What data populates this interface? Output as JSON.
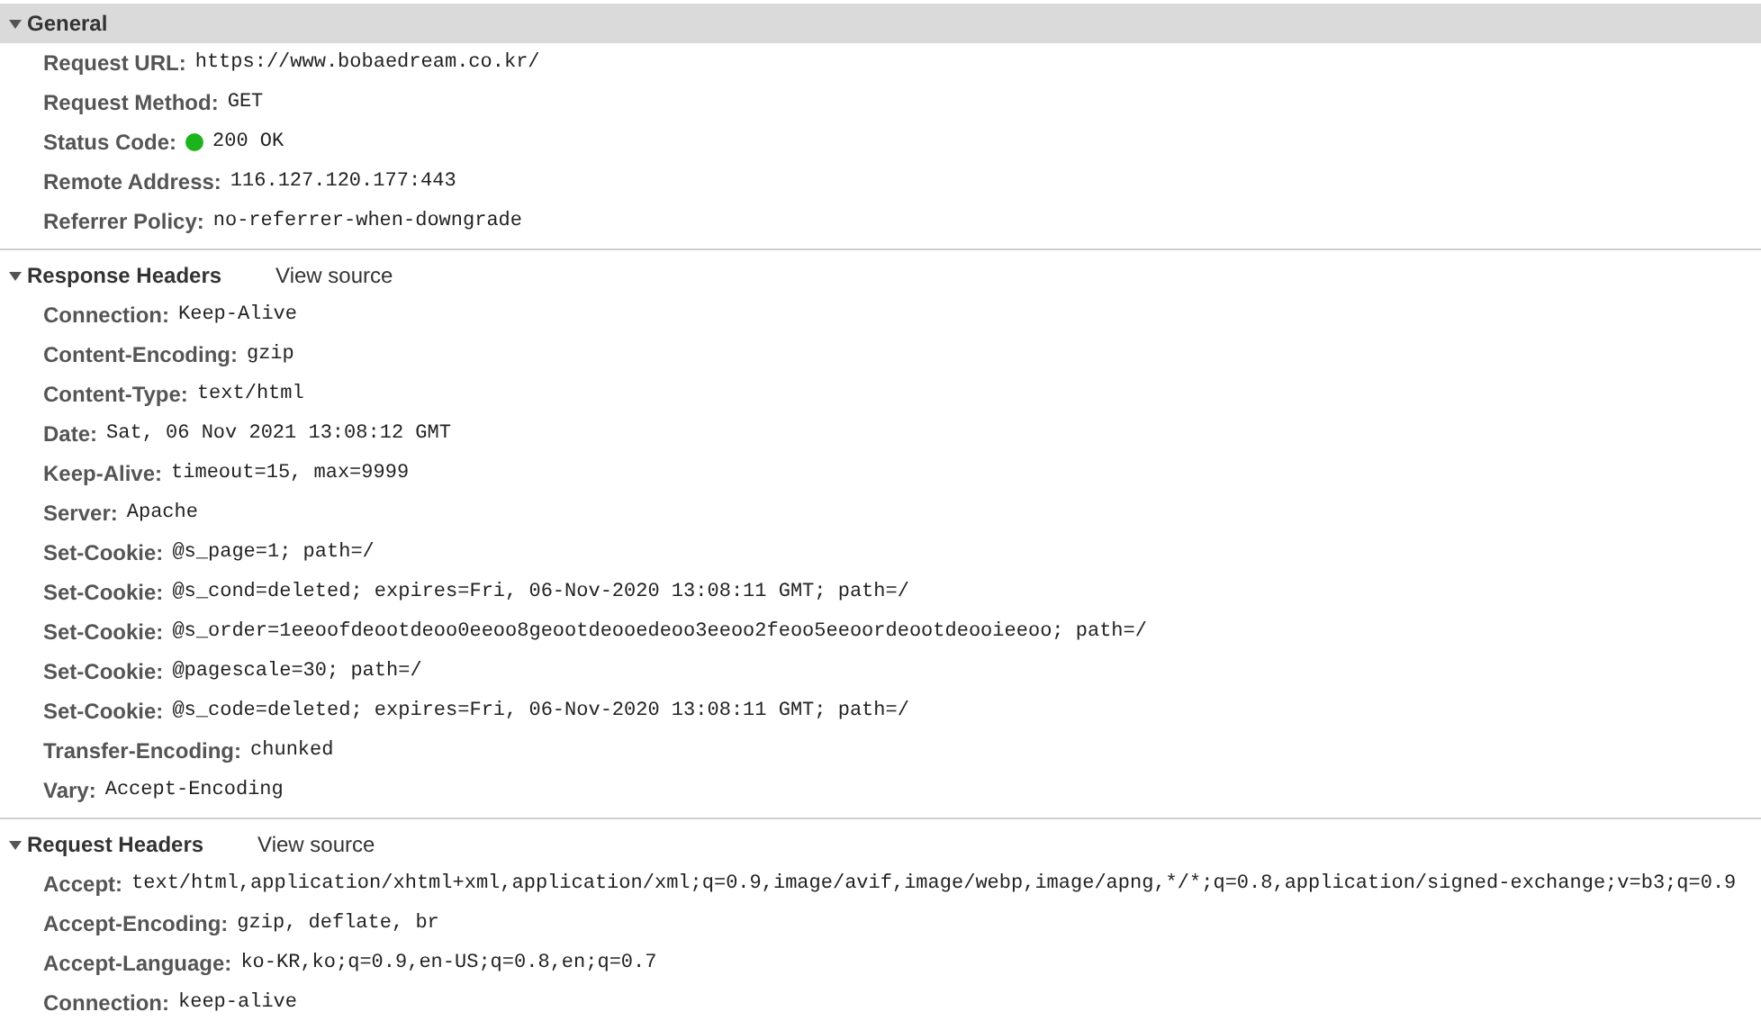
{
  "sections": [
    {
      "title": "General",
      "expanded": true,
      "selected": true,
      "rows": [
        {
          "name": "Request URL:",
          "value": "https://www.bobaedream.co.kr/"
        },
        {
          "name": "Request Method:",
          "value": "GET"
        },
        {
          "name": "Status Code:",
          "value": "200 OK",
          "color": "#1db31d"
        },
        {
          "name": "Remote Address:",
          "value": "116.127.120.177:443"
        },
        {
          "name": "Referrer Policy:",
          "value": "no-referrer-when-downgrade"
        }
      ]
    },
    {
      "title": "Response Headers",
      "link": "View source",
      "expanded": true,
      "selected": false,
      "rows": [
        {
          "name": "Connection:",
          "value": "Keep-Alive"
        },
        {
          "name": "Content-Encoding:",
          "value": "gzip"
        },
        {
          "name": "Content-Type:",
          "value": "text/html"
        },
        {
          "name": "Date:",
          "value": "Sat, 06 Nov 2021 13:08:12 GMT"
        },
        {
          "name": "Keep-Alive:",
          "value": "timeout=15, max=9999"
        },
        {
          "name": "Server:",
          "value": "Apache"
        },
        {
          "name": "Set-Cookie:",
          "value": "@s_page=1; path=/"
        },
        {
          "name": "Set-Cookie:",
          "value": "@s_cond=deleted; expires=Fri, 06-Nov-2020 13:08:11 GMT; path=/"
        },
        {
          "name": "Set-Cookie:",
          "value": "@s_order=1eeoofdeootdeoo0eeoo8geootdeooedeoo3eeoo2feoo5eeoordeootdeooieeoo; path=/"
        },
        {
          "name": "Set-Cookie:",
          "value": "@pagescale=30; path=/"
        },
        {
          "name": "Set-Cookie:",
          "value": "@s_code=deleted; expires=Fri, 06-Nov-2020 13:08:11 GMT; path=/"
        },
        {
          "name": "Transfer-Encoding:",
          "value": "chunked"
        },
        {
          "name": "Vary:",
          "value": "Accept-Encoding"
        }
      ]
    },
    {
      "title": "Request Headers",
      "link": "View source",
      "expanded": true,
      "selected": false,
      "rows": [
        {
          "name": "Accept:",
          "value": "text/html,application/xhtml+xml,application/xml;q=0.9,image/avif,image/webp,image/apng,*/*;q=0.8,application/signed-exchange;v=b3;q=0.9"
        },
        {
          "name": "Accept-Encoding:",
          "value": "gzip, deflate, br"
        },
        {
          "name": "Accept-Language:",
          "value": "ko-KR,ko;q=0.9,en-US;q=0.8,en;q=0.7"
        },
        {
          "name": "Connection:",
          "value": "keep-alive"
        }
      ]
    }
  ]
}
